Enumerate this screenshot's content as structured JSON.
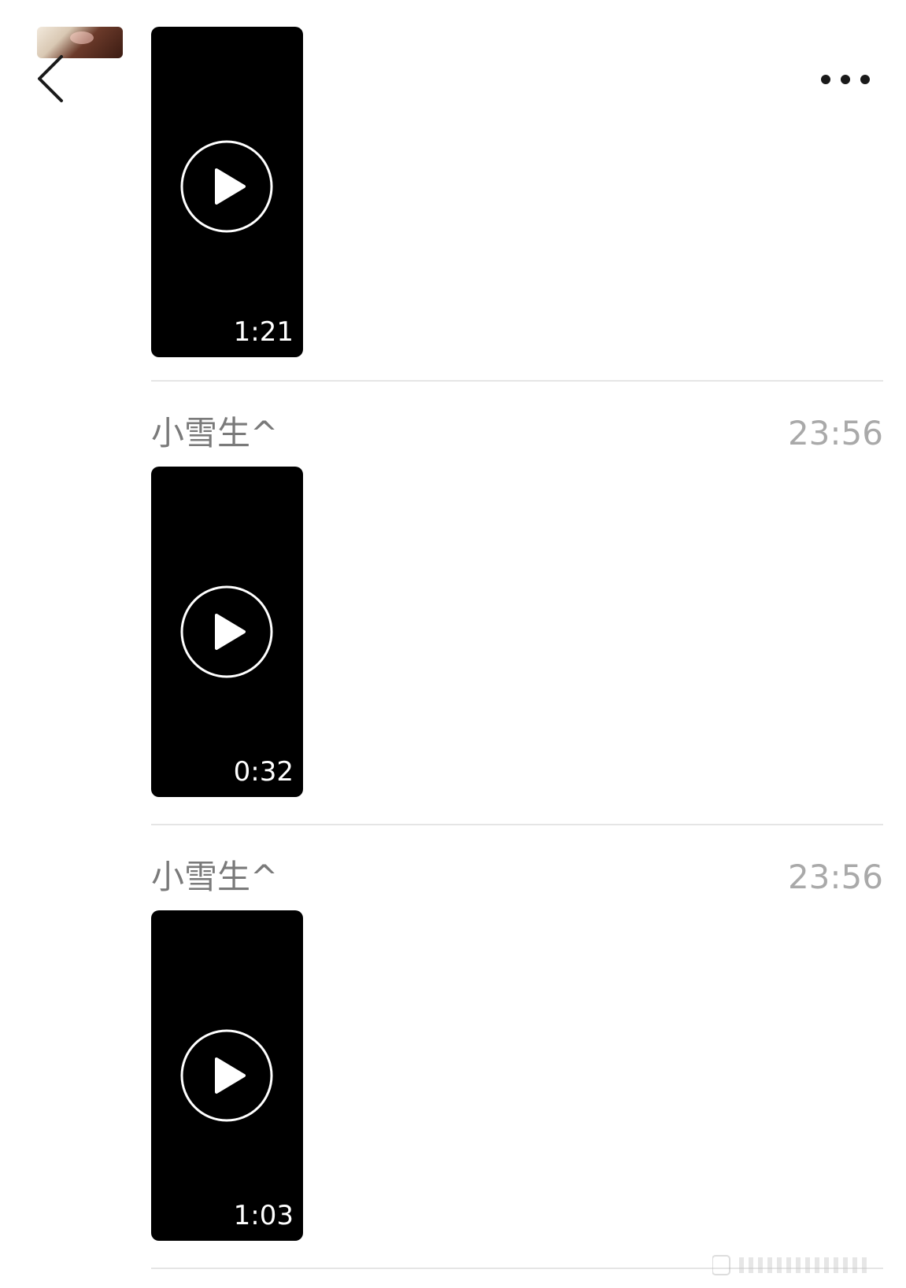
{
  "header": {
    "back_icon": "chevron-left-icon",
    "more_icon": "ellipsis-horizontal-icon"
  },
  "messages": [
    {
      "sender": "",
      "time": "",
      "duration": "1:21"
    },
    {
      "sender": "小雪生^",
      "time": "23:56",
      "duration": "0:32"
    },
    {
      "sender": "小雪生^",
      "time": "23:56",
      "duration": "1:03"
    }
  ],
  "colors": {
    "background": "#ffffff",
    "video_background": "#000000",
    "sender_text": "#7a7a7a",
    "time_text": "#a9a9a9",
    "divider": "#e5e5e5"
  }
}
